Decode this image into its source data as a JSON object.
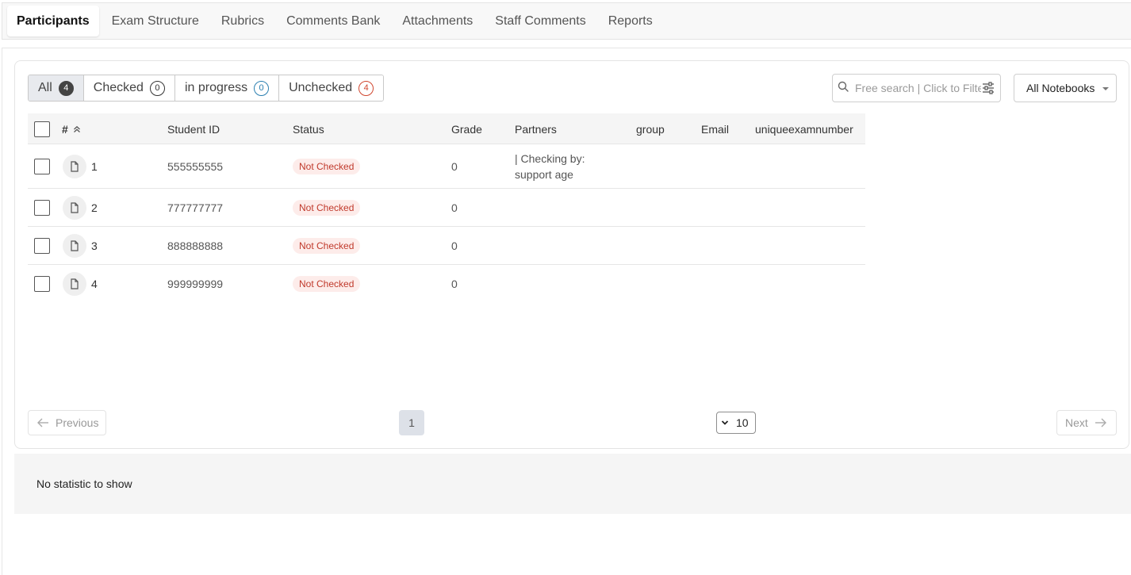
{
  "tabs": [
    {
      "label": "Participants",
      "active": true
    },
    {
      "label": "Exam Structure",
      "active": false
    },
    {
      "label": "Rubrics",
      "active": false
    },
    {
      "label": "Comments Bank",
      "active": false
    },
    {
      "label": "Attachments",
      "active": false
    },
    {
      "label": "Staff Comments",
      "active": false
    },
    {
      "label": "Reports",
      "active": false
    }
  ],
  "filters": [
    {
      "label": "All",
      "count": "4",
      "style": "dark",
      "active": true
    },
    {
      "label": "Checked",
      "count": "0",
      "style": "plain",
      "active": false
    },
    {
      "label": "in progress",
      "count": "0",
      "style": "blue",
      "active": false
    },
    {
      "label": "Unchecked",
      "count": "4",
      "style": "red",
      "active": false
    }
  ],
  "search": {
    "placeholder": "Free search | Click to Filter",
    "value": "",
    "icon": "search-icon",
    "filter_icon": "sliders-icon"
  },
  "notebook_select": {
    "value": "All Notebooks"
  },
  "table": {
    "headers": {
      "number": "#",
      "student_id": "Student ID",
      "status": "Status",
      "grade": "Grade",
      "partners": "Partners",
      "group": "group",
      "email": "Email",
      "unique": "uniqueexamnumber"
    },
    "rows": [
      {
        "number": "1",
        "student_id": "555555555",
        "status": "Not Checked",
        "grade": "0",
        "partners": "| Checking by:\nsupport age"
      },
      {
        "number": "2",
        "student_id": "777777777",
        "status": "Not Checked",
        "grade": "0",
        "partners": ""
      },
      {
        "number": "3",
        "student_id": "888888888",
        "status": "Not Checked",
        "grade": "0",
        "partners": ""
      },
      {
        "number": "4",
        "student_id": "999999999",
        "status": "Not Checked",
        "grade": "0",
        "partners": ""
      }
    ]
  },
  "pagination": {
    "previous_label": "Previous",
    "next_label": "Next",
    "current_page": "1",
    "page_size": "10"
  },
  "stats": {
    "message": "No statistic to show"
  },
  "colors": {
    "status_text": "#c0392b",
    "status_bg": "#fdecea",
    "in_progress_badge": "#2a7fb0",
    "unchecked_badge": "#d0462e"
  }
}
